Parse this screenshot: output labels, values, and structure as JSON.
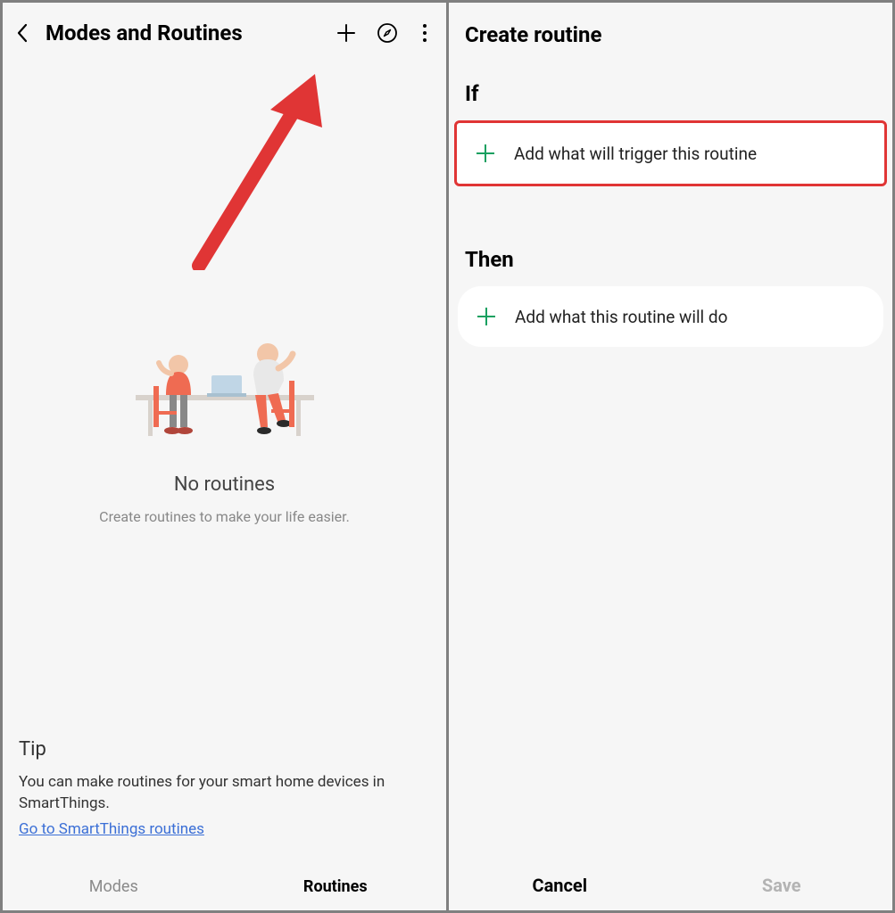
{
  "left": {
    "title": "Modes and Routines",
    "empty": {
      "title": "No routines",
      "subtitle": "Create routines to make your life easier."
    },
    "tip": {
      "heading": "Tip",
      "text": "You can make routines for your smart home devices in SmartThings.",
      "link": "Go to SmartThings routines"
    },
    "tabs": {
      "inactive": "Modes",
      "active": "Routines"
    }
  },
  "right": {
    "title": "Create routine",
    "sections": {
      "if": {
        "heading": "If",
        "card_label": "Add what will trigger this routine"
      },
      "then": {
        "heading": "Then",
        "card_label": "Add what this routine will do"
      }
    },
    "actions": {
      "cancel": "Cancel",
      "save": "Save"
    }
  }
}
